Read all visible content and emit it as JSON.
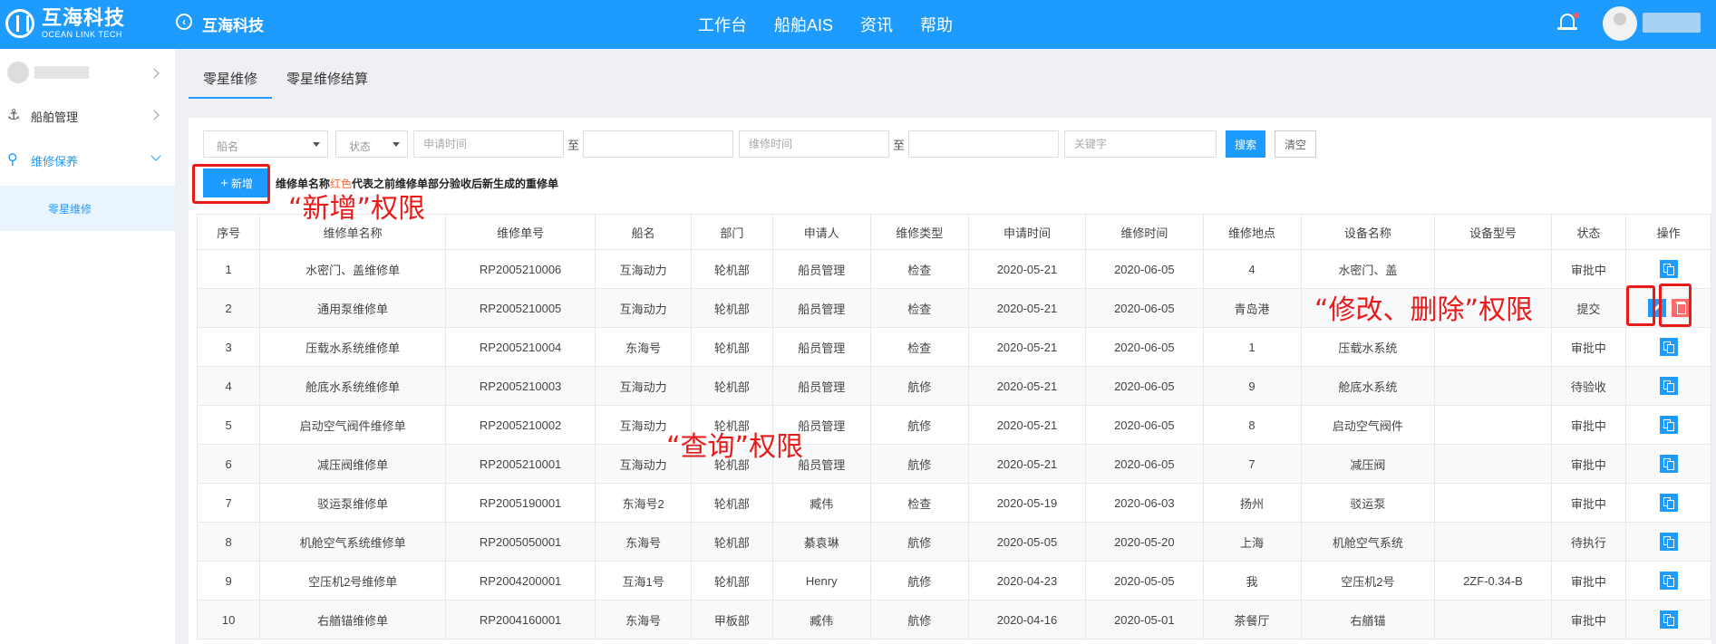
{
  "header": {
    "logo_cn": "互海科技",
    "logo_en": "OCEAN LINK TECH",
    "title": "互海科技",
    "nav": [
      "工作台",
      "船舶AIS",
      "资讯",
      "帮助"
    ]
  },
  "sidebar": {
    "items": [
      {
        "label": "船舶管理",
        "icon": "anchor-icon"
      },
      {
        "label": "维修保养",
        "icon": "wrench-icon"
      }
    ],
    "sub_item": "零星维修"
  },
  "tabs": [
    "零星维修",
    "零星维修结算"
  ],
  "filter": {
    "ship_placeholder": "船名",
    "status_placeholder": "状态",
    "apply_time_placeholder": "申请时间",
    "to": "至",
    "repair_time_placeholder": "维修时间",
    "keyword_placeholder": "关键字",
    "search_label": "搜索",
    "clear_label": "清空"
  },
  "add_label": "新增",
  "note": {
    "before": "维修单名称",
    "red": "红色",
    "after": "代表之前维修单部分验收后新生成的重修单"
  },
  "table": {
    "headers": [
      "序号",
      "维修单名称",
      "维修单号",
      "船名",
      "部门",
      "申请人",
      "维修类型",
      "申请时间",
      "维修时间",
      "维修地点",
      "设备名称",
      "设备型号",
      "状态",
      "操作"
    ],
    "rows": [
      [
        "1",
        "水密门、盖维修单",
        "RP2005210006",
        "互海动力",
        "轮机部",
        "船员管理",
        "检查",
        "2020-05-21",
        "2020-06-05",
        "4",
        "水密门、盖",
        "",
        "审批中"
      ],
      [
        "2",
        "通用泵维修单",
        "RP2005210005",
        "互海动力",
        "轮机部",
        "船员管理",
        "检查",
        "2020-05-21",
        "2020-06-05",
        "青岛港",
        "",
        "",
        "提交"
      ],
      [
        "3",
        "压载水系统维修单",
        "RP2005210004",
        "东海号",
        "轮机部",
        "船员管理",
        "检查",
        "2020-05-21",
        "2020-06-05",
        "1",
        "压载水系统",
        "",
        "审批中"
      ],
      [
        "4",
        "舱底水系统维修单",
        "RP2005210003",
        "互海动力",
        "轮机部",
        "船员管理",
        "航修",
        "2020-05-21",
        "2020-06-05",
        "9",
        "舱底水系统",
        "",
        "待验收"
      ],
      [
        "5",
        "启动空气阀件维修单",
        "RP2005210002",
        "互海动力",
        "轮机部",
        "船员管理",
        "航修",
        "2020-05-21",
        "2020-06-05",
        "8",
        "启动空气阀件",
        "",
        "审批中"
      ],
      [
        "6",
        "减压阀维修单",
        "RP2005210001",
        "互海动力",
        "轮机部",
        "船员管理",
        "航修",
        "2020-05-21",
        "2020-06-05",
        "7",
        "减压阀",
        "",
        "审批中"
      ],
      [
        "7",
        "驳运泵维修单",
        "RP2005190001",
        "东海号2",
        "轮机部",
        "臧伟",
        "检查",
        "2020-05-19",
        "2020-06-03",
        "扬州",
        "驳运泵",
        "",
        "审批中"
      ],
      [
        "8",
        "机舱空气系统维修单",
        "RP2005050001",
        "东海号",
        "轮机部",
        "綦袁琳",
        "航修",
        "2020-05-05",
        "2020-05-20",
        "上海",
        "机舱空气系统",
        "",
        "待执行"
      ],
      [
        "9",
        "空压机2号维修单",
        "RP2004200001",
        "互海1号",
        "轮机部",
        "Henry",
        "航修",
        "2020-04-23",
        "2020-05-05",
        "我",
        "空压机2号",
        "2ZF-0.34-B",
        "审批中"
      ],
      [
        "10",
        "右艏锚维修单",
        "RP2004160001",
        "东海号",
        "甲板部",
        "臧伟",
        "航修",
        "2020-04-16",
        "2020-05-01",
        "茶餐厅",
        "右艏锚",
        "",
        "审批中"
      ]
    ]
  },
  "annotations": {
    "add": "“新增”权限",
    "query": "“查询”权限",
    "edit_delete": "“修改、删除”权限"
  },
  "colors": {
    "primary": "#1e9bff",
    "annotation": "#e81a1a",
    "delete": "#ff6a6a"
  }
}
